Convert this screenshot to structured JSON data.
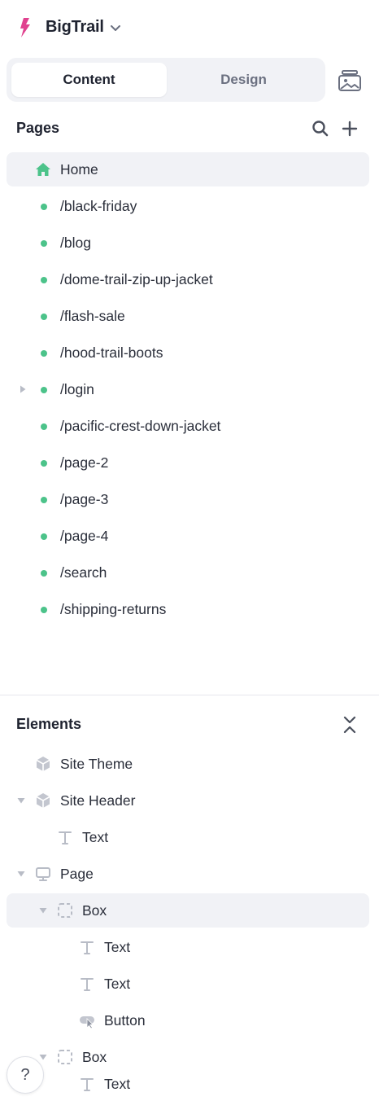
{
  "app": {
    "name": "BigTrail"
  },
  "tabs": {
    "content": "Content",
    "design": "Design"
  },
  "pages": {
    "title": "Pages",
    "items": [
      {
        "label": "Home"
      },
      {
        "label": "/black-friday"
      },
      {
        "label": "/blog"
      },
      {
        "label": "/dome-trail-zip-up-jacket"
      },
      {
        "label": "/flash-sale"
      },
      {
        "label": "/hood-trail-boots"
      },
      {
        "label": "/login"
      },
      {
        "label": "/pacific-crest-down-jacket"
      },
      {
        "label": "/page-2"
      },
      {
        "label": "/page-3"
      },
      {
        "label": "/page-4"
      },
      {
        "label": "/search"
      },
      {
        "label": "/shipping-returns"
      }
    ]
  },
  "elements": {
    "title": "Elements",
    "items": [
      {
        "label": "Site Theme",
        "icon": "cube-icon"
      },
      {
        "label": "Site Header",
        "icon": "cube-icon"
      },
      {
        "label": "Text",
        "icon": "text-icon"
      },
      {
        "label": "Page",
        "icon": "monitor-icon"
      },
      {
        "label": "Box",
        "icon": "box-icon"
      },
      {
        "label": "Text",
        "icon": "text-icon"
      },
      {
        "label": "Text",
        "icon": "text-icon"
      },
      {
        "label": "Button",
        "icon": "button-icon"
      },
      {
        "label": "Box",
        "icon": "box-icon"
      },
      {
        "label": "Text",
        "icon": "text-icon"
      }
    ]
  },
  "help": {
    "label": "?"
  },
  "colors": {
    "accent": "#e0418f",
    "status_green": "#4cc38a",
    "home_green": "#4cc38a",
    "selected_bg": "#f1f2f6"
  }
}
